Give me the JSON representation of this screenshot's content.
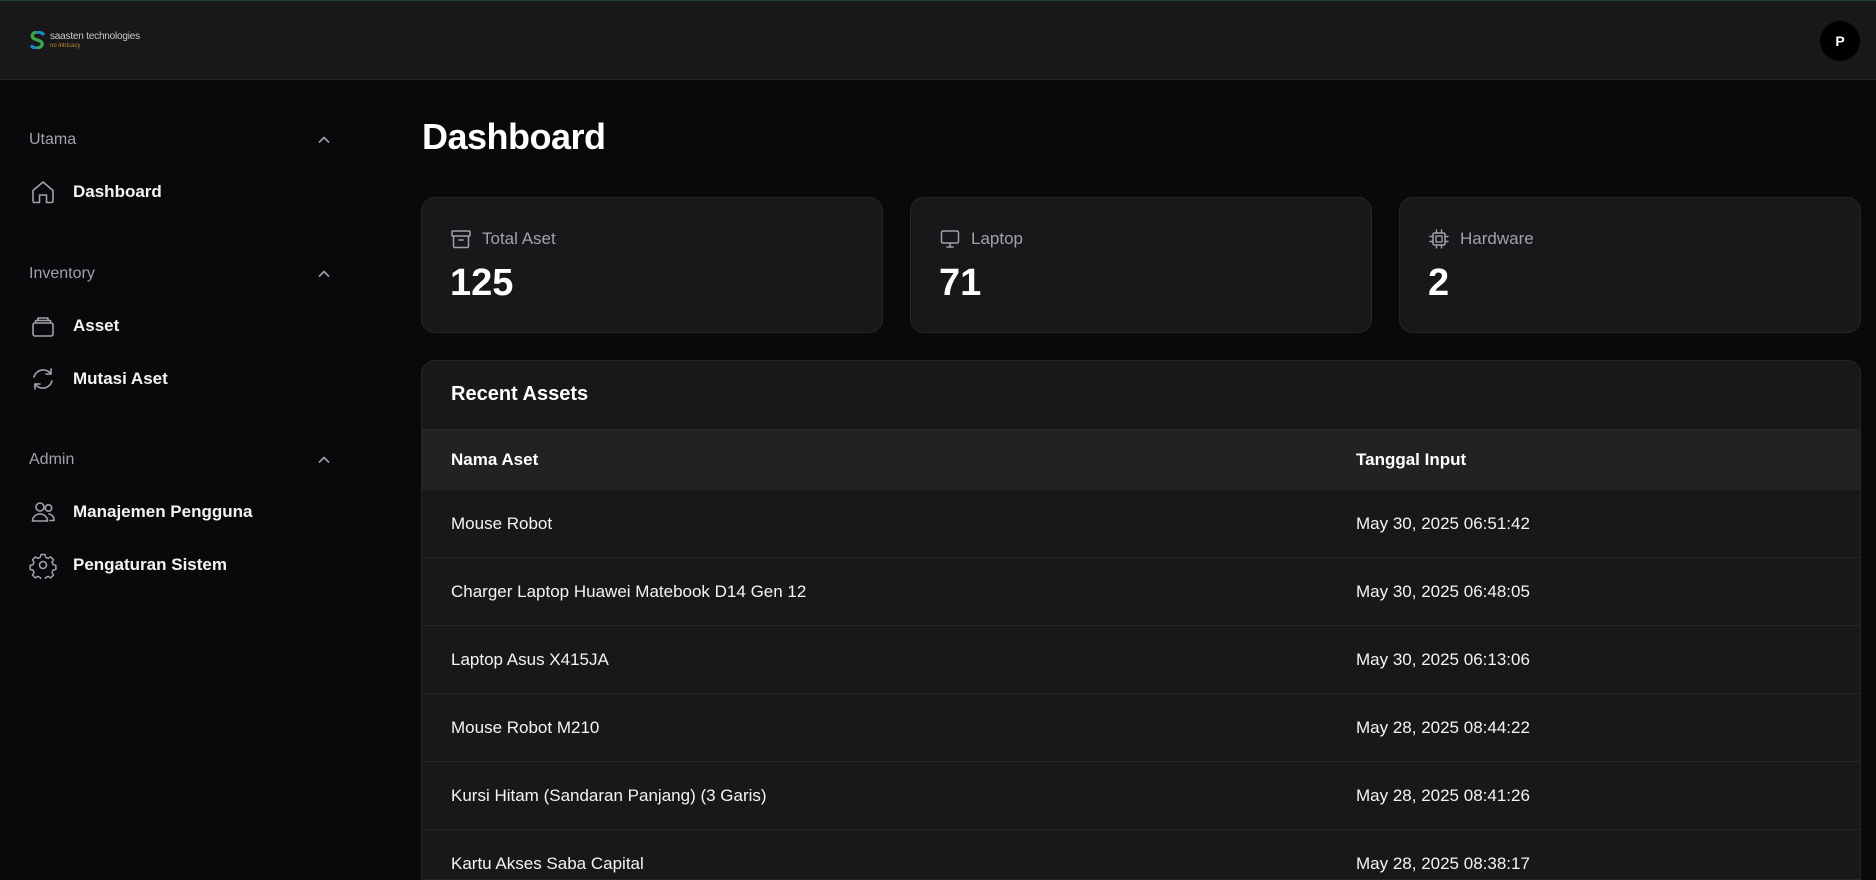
{
  "header": {
    "brand_name": "saasten technologies",
    "brand_tagline": "no intricacy",
    "avatar_initial": "P"
  },
  "sidebar": {
    "groups": [
      {
        "title": "Utama",
        "items": [
          {
            "label": "Dashboard",
            "icon": "home-icon"
          }
        ]
      },
      {
        "title": "Inventory",
        "items": [
          {
            "label": "Asset",
            "icon": "box-stack-icon"
          },
          {
            "label": "Mutasi Aset",
            "icon": "refresh-icon"
          }
        ]
      },
      {
        "title": "Admin",
        "items": [
          {
            "label": "Manajemen Pengguna",
            "icon": "users-icon"
          },
          {
            "label": "Pengaturan Sistem",
            "icon": "gear-icon"
          }
        ]
      }
    ]
  },
  "main": {
    "title": "Dashboard",
    "stats": [
      {
        "label": "Total Aset",
        "value": "125",
        "icon": "archive-icon"
      },
      {
        "label": "Laptop",
        "value": "71",
        "icon": "monitor-icon"
      },
      {
        "label": "Hardware",
        "value": "2",
        "icon": "cpu-icon"
      }
    ],
    "recent": {
      "title": "Recent Assets",
      "columns": [
        "Nama Aset",
        "Tanggal Input"
      ],
      "rows": [
        {
          "name": "Mouse Robot",
          "date": "May 30, 2025 06:51:42"
        },
        {
          "name": "Charger Laptop Huawei Matebook D14 Gen 12",
          "date": "May 30, 2025 06:48:05"
        },
        {
          "name": "Laptop Asus X415JA",
          "date": "May 30, 2025 06:13:06"
        },
        {
          "name": "Mouse Robot M210",
          "date": "May 28, 2025 08:44:22"
        },
        {
          "name": "Kursi Hitam (Sandaran Panjang) (3 Garis)",
          "date": "May 28, 2025 08:41:26"
        },
        {
          "name": "Kartu Akses Saba Capital",
          "date": "May 28, 2025 08:38:17"
        }
      ]
    }
  },
  "colors": {
    "background": "#09090b",
    "card": "#18181b",
    "border": "#27272a",
    "muted_text": "#a1a1aa",
    "brand_green": "#3aa64a",
    "brand_blue": "#1e88c8"
  }
}
